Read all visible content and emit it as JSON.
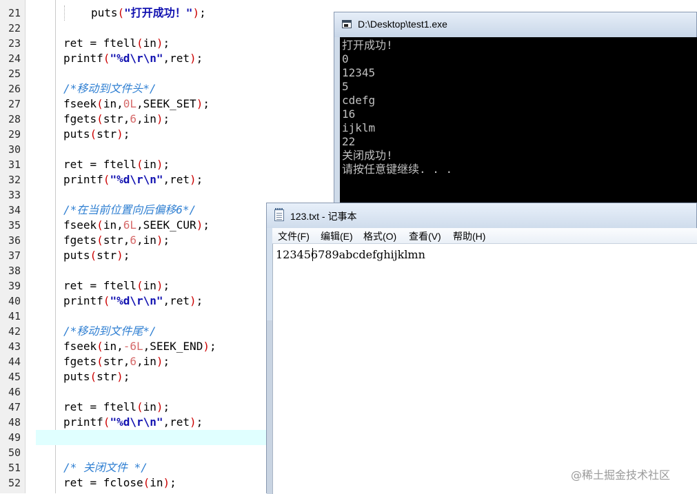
{
  "editor": {
    "lines": [
      {
        "no": "21",
        "indent": 2,
        "tokens": [
          [
            "t",
            "puts"
          ],
          [
            "p",
            "("
          ],
          [
            "s",
            "\"打开成功！\""
          ],
          [
            "p",
            ")"
          ],
          [
            "t",
            ";"
          ]
        ]
      },
      {
        "no": "22",
        "indent": 0,
        "tokens": []
      },
      {
        "no": "23",
        "indent": 1,
        "tokens": [
          [
            "t",
            "ret = ftell"
          ],
          [
            "p",
            "("
          ],
          [
            "t",
            "in"
          ],
          [
            "p",
            ")"
          ],
          [
            "t",
            ";"
          ]
        ]
      },
      {
        "no": "24",
        "indent": 1,
        "tokens": [
          [
            "t",
            "printf"
          ],
          [
            "p",
            "("
          ],
          [
            "s",
            "\"%d\\r\\n\""
          ],
          [
            "t",
            ",ret"
          ],
          [
            "p",
            ")"
          ],
          [
            "t",
            ";"
          ]
        ]
      },
      {
        "no": "25",
        "indent": 0,
        "tokens": []
      },
      {
        "no": "26",
        "indent": 1,
        "tokens": [
          [
            "c",
            "/*移动到文件头*/"
          ]
        ]
      },
      {
        "no": "27",
        "indent": 1,
        "tokens": [
          [
            "t",
            "fseek"
          ],
          [
            "p",
            "("
          ],
          [
            "t",
            "in,"
          ],
          [
            "n",
            "0L"
          ],
          [
            "t",
            ",SEEK_SET"
          ],
          [
            "p",
            ")"
          ],
          [
            "t",
            ";"
          ]
        ]
      },
      {
        "no": "28",
        "indent": 1,
        "tokens": [
          [
            "t",
            "fgets"
          ],
          [
            "p",
            "("
          ],
          [
            "t",
            "str,"
          ],
          [
            "n",
            "6"
          ],
          [
            "t",
            ",in"
          ],
          [
            "p",
            ")"
          ],
          [
            "t",
            ";"
          ]
        ]
      },
      {
        "no": "29",
        "indent": 1,
        "tokens": [
          [
            "t",
            "puts"
          ],
          [
            "p",
            "("
          ],
          [
            "t",
            "str"
          ],
          [
            "p",
            ")"
          ],
          [
            "t",
            ";"
          ]
        ]
      },
      {
        "no": "30",
        "indent": 0,
        "tokens": []
      },
      {
        "no": "31",
        "indent": 1,
        "tokens": [
          [
            "t",
            "ret = ftell"
          ],
          [
            "p",
            "("
          ],
          [
            "t",
            "in"
          ],
          [
            "p",
            ")"
          ],
          [
            "t",
            ";"
          ]
        ]
      },
      {
        "no": "32",
        "indent": 1,
        "tokens": [
          [
            "t",
            "printf"
          ],
          [
            "p",
            "("
          ],
          [
            "s",
            "\"%d\\r\\n\""
          ],
          [
            "t",
            ",ret"
          ],
          [
            "p",
            ")"
          ],
          [
            "t",
            ";"
          ]
        ]
      },
      {
        "no": "33",
        "indent": 0,
        "tokens": []
      },
      {
        "no": "34",
        "indent": 1,
        "tokens": [
          [
            "c",
            "/*在当前位置向后偏移6*/"
          ]
        ]
      },
      {
        "no": "35",
        "indent": 1,
        "tokens": [
          [
            "t",
            "fseek"
          ],
          [
            "p",
            "("
          ],
          [
            "t",
            "in,"
          ],
          [
            "n",
            "6L"
          ],
          [
            "t",
            ",SEEK_CUR"
          ],
          [
            "p",
            ")"
          ],
          [
            "t",
            ";"
          ]
        ]
      },
      {
        "no": "36",
        "indent": 1,
        "tokens": [
          [
            "t",
            "fgets"
          ],
          [
            "p",
            "("
          ],
          [
            "t",
            "str,"
          ],
          [
            "n",
            "6"
          ],
          [
            "t",
            ",in"
          ],
          [
            "p",
            ")"
          ],
          [
            "t",
            ";"
          ]
        ]
      },
      {
        "no": "37",
        "indent": 1,
        "tokens": [
          [
            "t",
            "puts"
          ],
          [
            "p",
            "("
          ],
          [
            "t",
            "str"
          ],
          [
            "p",
            ")"
          ],
          [
            "t",
            ";"
          ]
        ]
      },
      {
        "no": "38",
        "indent": 0,
        "tokens": []
      },
      {
        "no": "39",
        "indent": 1,
        "tokens": [
          [
            "t",
            "ret = ftell"
          ],
          [
            "p",
            "("
          ],
          [
            "t",
            "in"
          ],
          [
            "p",
            ")"
          ],
          [
            "t",
            ";"
          ]
        ]
      },
      {
        "no": "40",
        "indent": 1,
        "tokens": [
          [
            "t",
            "printf"
          ],
          [
            "p",
            "("
          ],
          [
            "s",
            "\"%d\\r\\n\""
          ],
          [
            "t",
            ",ret"
          ],
          [
            "p",
            ")"
          ],
          [
            "t",
            ";"
          ]
        ]
      },
      {
        "no": "41",
        "indent": 0,
        "tokens": []
      },
      {
        "no": "42",
        "indent": 1,
        "tokens": [
          [
            "c",
            "/*移动到文件尾*/"
          ]
        ]
      },
      {
        "no": "43",
        "indent": 1,
        "tokens": [
          [
            "t",
            "fseek"
          ],
          [
            "p",
            "("
          ],
          [
            "t",
            "in,"
          ],
          [
            "n",
            "-6L"
          ],
          [
            "t",
            ",SEEK_END"
          ],
          [
            "p",
            ")"
          ],
          [
            "t",
            ";"
          ]
        ]
      },
      {
        "no": "44",
        "indent": 1,
        "tokens": [
          [
            "t",
            "fgets"
          ],
          [
            "p",
            "("
          ],
          [
            "t",
            "str,"
          ],
          [
            "n",
            "6"
          ],
          [
            "t",
            ",in"
          ],
          [
            "p",
            ")"
          ],
          [
            "t",
            ";"
          ]
        ]
      },
      {
        "no": "45",
        "indent": 1,
        "tokens": [
          [
            "t",
            "puts"
          ],
          [
            "p",
            "("
          ],
          [
            "t",
            "str"
          ],
          [
            "p",
            ")"
          ],
          [
            "t",
            ";"
          ]
        ]
      },
      {
        "no": "46",
        "indent": 0,
        "tokens": []
      },
      {
        "no": "47",
        "indent": 1,
        "tokens": [
          [
            "t",
            "ret = ftell"
          ],
          [
            "p",
            "("
          ],
          [
            "t",
            "in"
          ],
          [
            "p",
            ")"
          ],
          [
            "t",
            ";"
          ]
        ]
      },
      {
        "no": "48",
        "indent": 1,
        "tokens": [
          [
            "t",
            "printf"
          ],
          [
            "p",
            "("
          ],
          [
            "s",
            "\"%d\\r\\n\""
          ],
          [
            "t",
            ",ret"
          ],
          [
            "p",
            ")"
          ],
          [
            "t",
            ";"
          ]
        ]
      },
      {
        "no": "49",
        "indent": 0,
        "tokens": [],
        "current": true
      },
      {
        "no": "50",
        "indent": 0,
        "tokens": []
      },
      {
        "no": "51",
        "indent": 1,
        "tokens": [
          [
            "c",
            "/* 关闭文件 */"
          ]
        ]
      },
      {
        "no": "52",
        "indent": 1,
        "tokens": [
          [
            "t",
            "ret = fclose"
          ],
          [
            "p",
            "("
          ],
          [
            "t",
            "in"
          ],
          [
            "p",
            ")"
          ],
          [
            "t",
            ";"
          ]
        ]
      }
    ]
  },
  "console": {
    "title": "D:\\Desktop\\test1.exe",
    "lines": [
      "打开成功!",
      "0",
      "12345",
      "5",
      "cdefg",
      "16",
      "ijklm",
      "22",
      "关闭成功!",
      "请按任意键继续. . ."
    ]
  },
  "notepad": {
    "title": "123.txt - 记事本",
    "menu": [
      "文件(F)",
      "编辑(E)",
      "格式(O)",
      "查看(V)",
      "帮助(H)"
    ],
    "content": "123456789abcdefghijklmn"
  },
  "watermark": "@稀土掘金技术社区"
}
